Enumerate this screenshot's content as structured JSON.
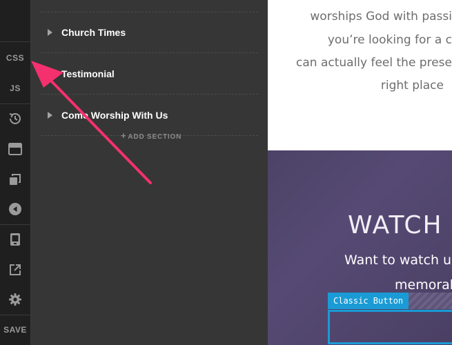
{
  "rail": {
    "css_label": "CSS",
    "js_label": "JS",
    "save_label": "SAVE"
  },
  "sections": [
    {
      "label": "Church Times"
    },
    {
      "label": "Testimonial"
    },
    {
      "label": "Come Worship With Us"
    }
  ],
  "add_section_label": "ADD SECTION",
  "preview": {
    "paragraph_lines": [
      "worships God with passi",
      "you’re looking for a c",
      "can actually feel the prese",
      "right place"
    ],
    "hero_title": "WATCH",
    "hero_sub_lines": [
      "Want to watch us",
      "memorab"
    ],
    "element_tag": "Classic Button"
  },
  "colors": {
    "accent": "#1a9bd6",
    "annotation_arrow": "#f5306e"
  }
}
